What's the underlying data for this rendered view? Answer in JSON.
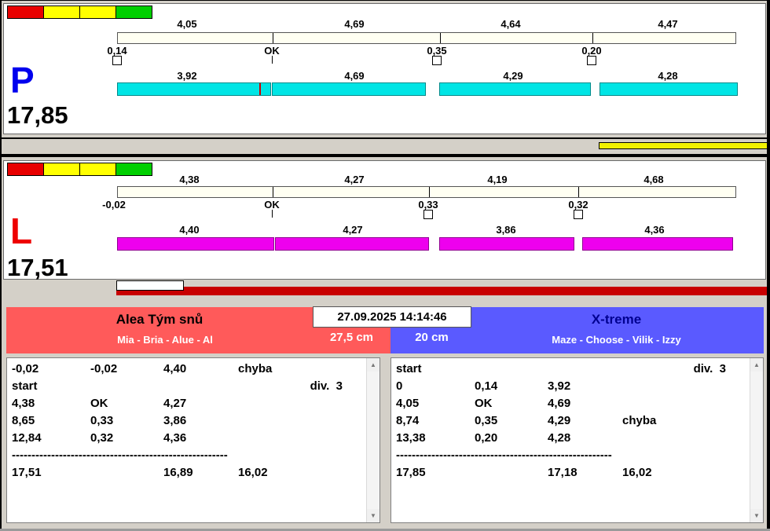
{
  "colors": {
    "window_bg": "#d4d0c8",
    "panel_bg": "#ffffff",
    "cream": "#fffff2",
    "cyan": "#00e5e5",
    "magenta": "#ee00ee",
    "traffic_red": "#e80000",
    "traffic_yellow": "#ffff00",
    "traffic_green": "#00cf00",
    "divider_yellow": "#f2f200",
    "progress_red": "#c80000",
    "team_left_bg": "#ff5a5a",
    "team_right_bg": "#5a5aff",
    "lane_p": "#0000ee",
    "lane_l": "#ee0000"
  },
  "lanes": [
    {
      "letter": "P",
      "total": "17,85",
      "splits_top": [
        "4,05",
        "4,69",
        "4,64",
        "4,47"
      ],
      "marks": [
        {
          "label": "0,14",
          "indicator": "box"
        },
        {
          "label": "OK",
          "indicator": "tick"
        },
        {
          "label": "0,35",
          "indicator": "box"
        },
        {
          "label": "0,20",
          "indicator": "box"
        }
      ],
      "splits_bottom": [
        "3,92",
        "4,69",
        "4,29",
        "4,28"
      ]
    },
    {
      "letter": "L",
      "total": "17,51",
      "splits_top": [
        "4,38",
        "4,27",
        "4,19",
        "4,68"
      ],
      "marks": [
        {
          "label": "-0,02",
          "indicator": "none"
        },
        {
          "label": "OK",
          "indicator": "tick"
        },
        {
          "label": "0,33",
          "indicator": "box"
        },
        {
          "label": "0,32",
          "indicator": "box"
        }
      ],
      "splits_bottom": [
        "4,40",
        "4,27",
        "3,86",
        "4,36"
      ]
    }
  ],
  "footer": {
    "datetime": "27.09.2025 14:14:46",
    "teams": [
      {
        "name": "Alea Tým snů",
        "members": "Mia - Bria - Alue - Al",
        "jump_height": "27,5 cm"
      },
      {
        "name": "X-treme",
        "members": "Maze - Choose - Vilik - Izzy",
        "jump_height": "20 cm"
      }
    ],
    "logs": [
      {
        "rows": [
          [
            "-0,02",
            "-0,02",
            "4,40",
            "chyba",
            ""
          ],
          [
            "start",
            "",
            "",
            "",
            "div.  3"
          ],
          [
            "4,38",
            "OK",
            "4,27",
            "",
            ""
          ],
          [
            "8,65",
            "0,33",
            "3,86",
            "",
            ""
          ],
          [
            "12,84",
            "0,32",
            "4,36",
            "",
            ""
          ],
          "-------------------------------------------------------",
          [
            "17,51",
            "",
            "16,89",
            "16,02",
            ""
          ]
        ]
      },
      {
        "rows": [
          [
            "start",
            "",
            "",
            "",
            "div.  3"
          ],
          [
            "0",
            "0,14",
            "3,92",
            "",
            ""
          ],
          [
            "4,05",
            "OK",
            "4,69",
            "",
            ""
          ],
          [
            "8,74",
            "0,35",
            "4,29",
            "chyba",
            ""
          ],
          [
            "13,38",
            "0,20",
            "4,28",
            "",
            ""
          ],
          "-------------------------------------------------------",
          [
            "17,85",
            "",
            "17,18",
            "16,02",
            ""
          ]
        ]
      }
    ]
  }
}
